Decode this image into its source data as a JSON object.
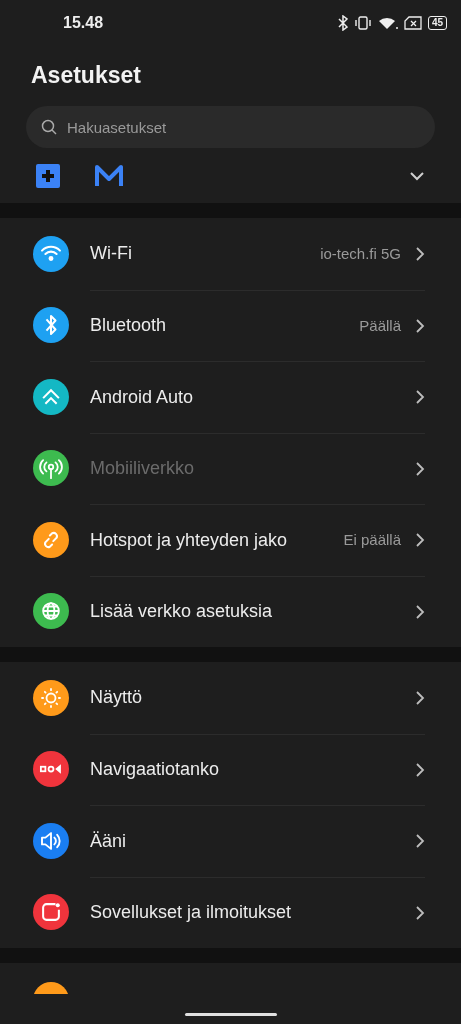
{
  "status_bar": {
    "time": "15.48",
    "battery": "45"
  },
  "title": "Asetukset",
  "search": {
    "placeholder": "Hakuasetukset"
  },
  "sections": [
    {
      "items": [
        {
          "label": "Wi-Fi",
          "value": "io-tech.fi 5G",
          "color": "#1ea1f2",
          "disabled": false
        },
        {
          "label": "Bluetooth",
          "value": "Päällä",
          "color": "#1ea1f2",
          "disabled": false
        },
        {
          "label": "Android Auto",
          "color": "#14b8c4",
          "disabled": false
        },
        {
          "label": "Mobiiliverkko",
          "color": "#3dbb4f",
          "disabled": true
        },
        {
          "label": "Hotspot ja yhteyden jako",
          "value": "Ei päällä",
          "color": "#ff9a1a",
          "disabled": false
        },
        {
          "label": "Lisää verkko asetuksia",
          "color": "#3dbb4f",
          "disabled": false
        }
      ]
    },
    {
      "items": [
        {
          "label": "Näyttö",
          "color": "#ff9a1a",
          "disabled": false
        },
        {
          "label": "Navigaatiotanko",
          "color": "#f0343c",
          "disabled": false
        },
        {
          "label": "Ääni",
          "color": "#1a7ef2",
          "disabled": false
        },
        {
          "label": "Sovellukset ja ilmoitukset",
          "color": "#f0343c",
          "disabled": false
        }
      ]
    }
  ],
  "partial_item": {
    "color": "#ff9a1a"
  }
}
